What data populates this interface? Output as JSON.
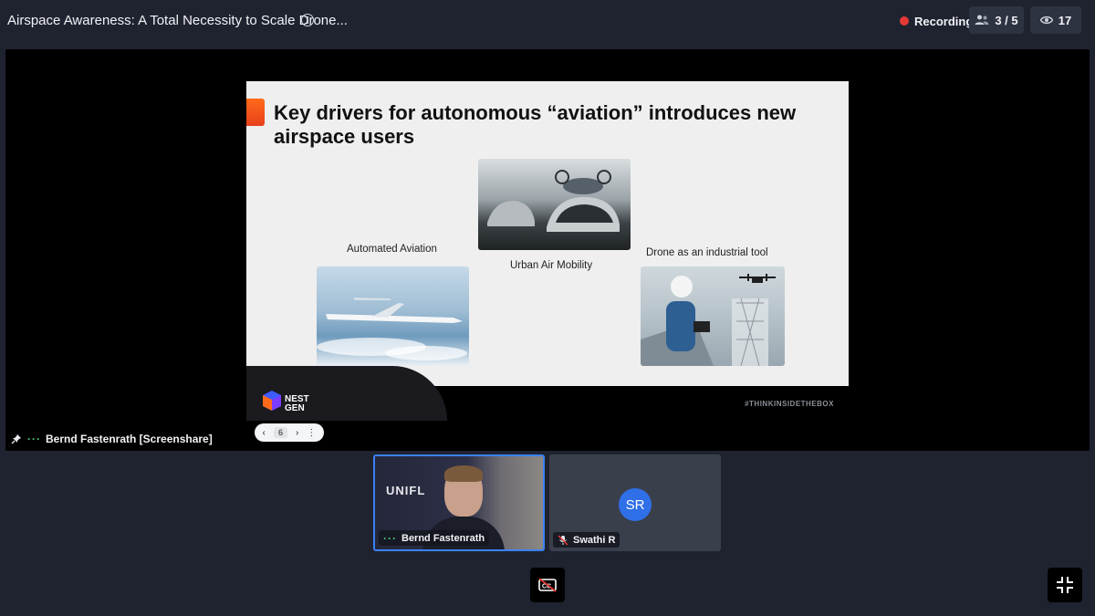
{
  "header": {
    "title": "Airspace Awareness: A Total Necessity to Scale Drone...",
    "recording_label": "Recording",
    "participants_count": "3 / 5",
    "viewers_count": "17",
    "icons": [
      "info-icon",
      "people-icon",
      "eye-icon"
    ]
  },
  "slide": {
    "title": "Key drivers for autonomous “aviation” introduces new airspace users",
    "items": [
      {
        "caption": "Automated Aviation"
      },
      {
        "caption": "Urban Air Mobility"
      },
      {
        "caption": "Drone as an industrial tool"
      }
    ],
    "hashtag": "#THINKINSIDETHEBOX",
    "logo_text": "NEST GEN"
  },
  "pager": {
    "current_page": "6",
    "prev_symbol": "‹",
    "next_symbol": "›",
    "more_symbol": "⋮"
  },
  "stage": {
    "presenter_label": "Bernd Fastenrath [Screenshare]"
  },
  "tiles": [
    {
      "name": "Bernd Fastenrath",
      "background_text": "UNIFL",
      "active": true
    },
    {
      "name": "Swathi R",
      "initials": "SR",
      "muted": true
    }
  ],
  "colors": {
    "background": "#1f2330",
    "accent": "#3b82f6",
    "recording": "#e53935",
    "speaking": "#4fce7d",
    "avatar": "#2f6fe8"
  }
}
